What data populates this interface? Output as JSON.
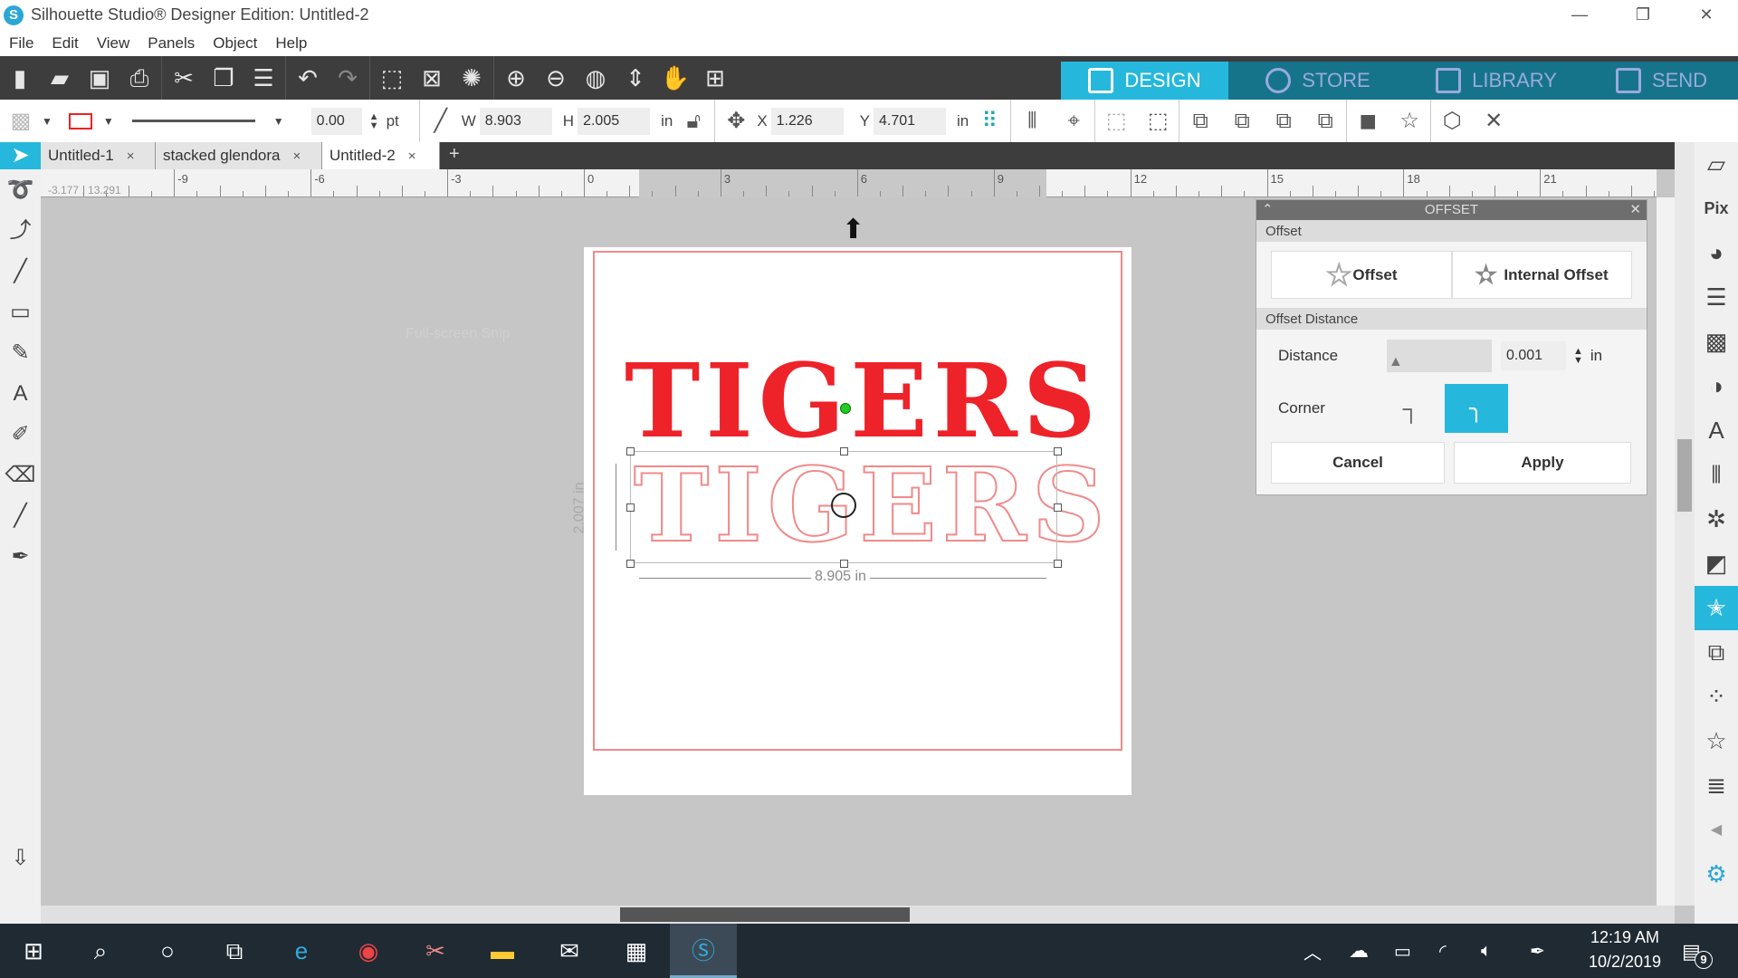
{
  "window": {
    "title": "Silhouette Studio® Designer Edition: Untitled-2",
    "minimize": "—",
    "restore": "❐",
    "close": "✕"
  },
  "menu": [
    "File",
    "Edit",
    "View",
    "Panels",
    "Object",
    "Help"
  ],
  "modes": [
    {
      "label": "DESIGN",
      "active": true
    },
    {
      "label": "STORE"
    },
    {
      "label": "LIBRARY"
    },
    {
      "label": "SEND"
    }
  ],
  "toolbar2": {
    "line_width": "0.00",
    "line_unit": "pt",
    "w_label": "W",
    "w": "8.903",
    "h_label": "H",
    "h": "2.005",
    "size_unit": "in",
    "x_label": "X",
    "x": "1.226",
    "y_label": "Y",
    "y": "4.701",
    "pos_unit": "in"
  },
  "tabs": [
    {
      "label": "Untitled-1"
    },
    {
      "label": "stacked glendora"
    },
    {
      "label": "Untitled-2",
      "active": true
    }
  ],
  "tab_close": "×",
  "tab_add": "+",
  "ruler": {
    "coords": "-3.177 , 13.291",
    "labels": [
      "-9",
      "-6",
      "-3",
      "0",
      "3",
      "6",
      "9",
      "12",
      "15",
      "18",
      "21"
    ]
  },
  "canvas": {
    "text_fill": "TIGERS",
    "text_outline": "TIGERS",
    "width_dim": "8.905 in",
    "height_dim": "2.007 in",
    "watermark": "Full-screen Snip",
    "fill_color": "#ee2229",
    "outline_color": "#f08a8a"
  },
  "offset_panel": {
    "title": "OFFSET",
    "section1": "Offset",
    "offset_btn": "Offset",
    "internal_btn": "Internal Offset",
    "section2": "Offset Distance",
    "distance_label": "Distance",
    "distance_value": "0.001",
    "distance_unit": "in",
    "corner_label": "Corner",
    "corner_selected": "round",
    "cancel": "Cancel",
    "apply": "Apply"
  },
  "taskbar": {
    "time": "12:19 AM",
    "date": "10/2/2019",
    "notifications": "9"
  },
  "colors": {
    "accent": "#25b8dc",
    "mode_bar": "#16748a",
    "toolbar": "#3d3d3d"
  }
}
